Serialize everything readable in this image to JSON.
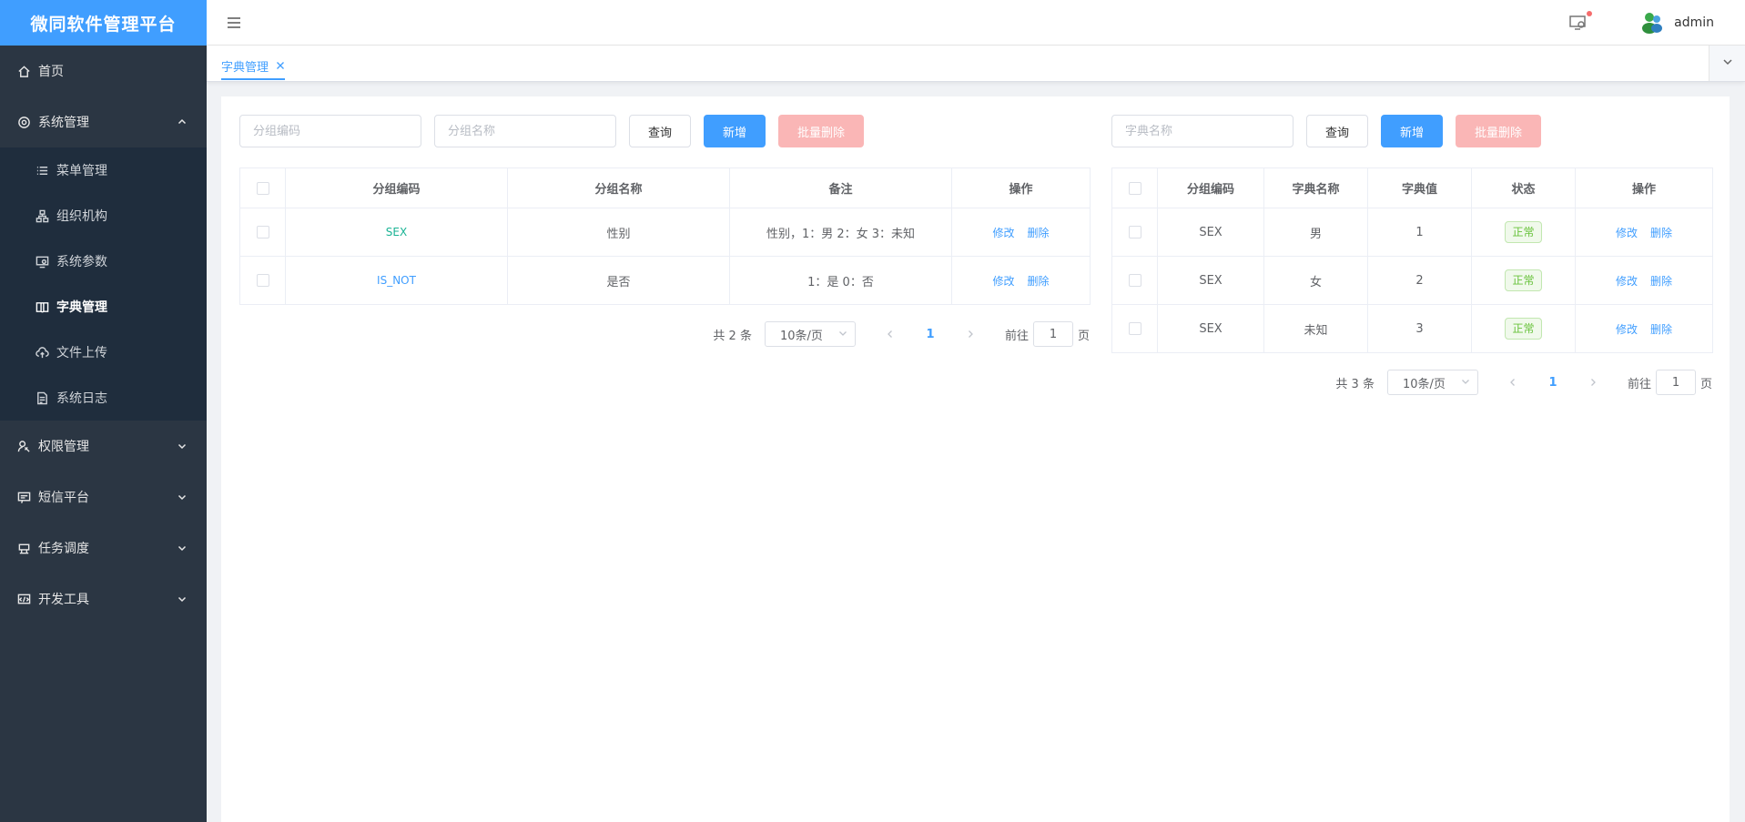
{
  "brand": "微同软件管理平台",
  "sidebar": {
    "items": [
      {
        "label": "首页",
        "icon": "home-icon"
      },
      {
        "label": "系统管理",
        "icon": "gear-icon",
        "expanded": true,
        "children": [
          {
            "label": "菜单管理",
            "icon": "list-icon"
          },
          {
            "label": "组织机构",
            "icon": "org-icon"
          },
          {
            "label": "系统参数",
            "icon": "params-icon"
          },
          {
            "label": "字典管理",
            "icon": "book-icon",
            "active": true
          },
          {
            "label": "文件上传",
            "icon": "upload-cloud-icon"
          },
          {
            "label": "系统日志",
            "icon": "log-icon"
          }
        ]
      },
      {
        "label": "权限管理",
        "icon": "permission-icon"
      },
      {
        "label": "短信平台",
        "icon": "sms-icon"
      },
      {
        "label": "任务调度",
        "icon": "task-icon"
      },
      {
        "label": "开发工具",
        "icon": "dev-tool-icon"
      }
    ]
  },
  "header": {
    "username": "admin"
  },
  "tags": {
    "active": "字典管理"
  },
  "left_panel": {
    "filters": {
      "code_placeholder": "分组编码",
      "name_placeholder": "分组名称"
    },
    "buttons": {
      "query": "查询",
      "add": "新增",
      "batch_delete": "批量删除"
    },
    "columns": [
      "分组编码",
      "分组名称",
      "备注",
      "操作"
    ],
    "rows": [
      {
        "code": "SEX",
        "name": "性别",
        "remark": "性别，1：男 2：女 3：未知",
        "edit": "修改",
        "delete": "删除"
      },
      {
        "code": "IS_NOT",
        "name": "是否",
        "remark": "1：是 0：否",
        "edit": "修改",
        "delete": "删除"
      }
    ],
    "pager": {
      "total": "共 2 条",
      "size": "10条/页",
      "current": "1",
      "goto_label": "前往",
      "goto_value": "1",
      "page_suffix": "页"
    }
  },
  "right_panel": {
    "filters": {
      "name_placeholder": "字典名称"
    },
    "buttons": {
      "query": "查询",
      "add": "新增",
      "batch_delete": "批量删除"
    },
    "columns": [
      "分组编码",
      "字典名称",
      "字典值",
      "状态",
      "操作"
    ],
    "rows": [
      {
        "code": "SEX",
        "name": "男",
        "value": "1",
        "status": "正常",
        "edit": "修改",
        "delete": "删除"
      },
      {
        "code": "SEX",
        "name": "女",
        "value": "2",
        "status": "正常",
        "edit": "修改",
        "delete": "删除"
      },
      {
        "code": "SEX",
        "name": "未知",
        "value": "3",
        "status": "正常",
        "edit": "修改",
        "delete": "删除"
      }
    ],
    "pager": {
      "total": "共 3 条",
      "size": "10条/页",
      "current": "1",
      "goto_label": "前往",
      "goto_value": "1",
      "page_suffix": "页"
    }
  },
  "colors": {
    "primary": "#409eff",
    "sidebar_bg": "#2b3643",
    "submenu_bg": "#1f2d3d",
    "danger_disabled": "#fab6b6",
    "success": "#67c23a"
  }
}
